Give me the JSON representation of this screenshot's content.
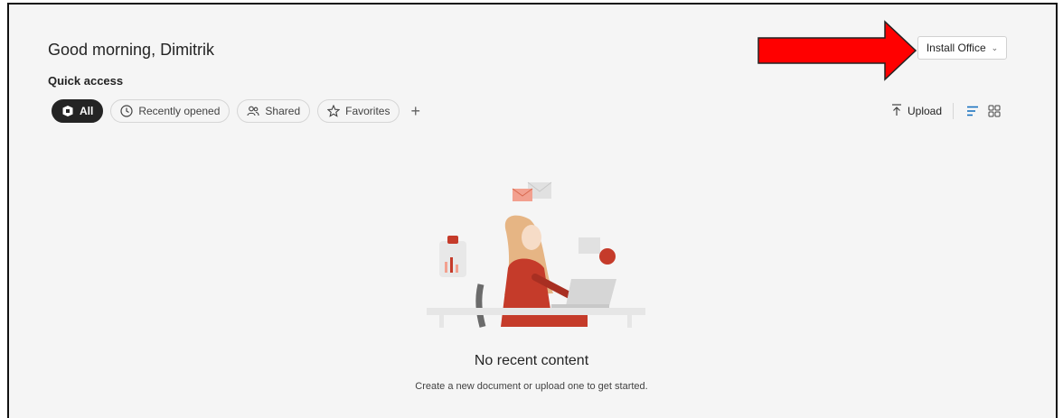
{
  "header": {
    "greeting": "Good morning, Dimitrik",
    "install_label": "Install Office"
  },
  "quick_access": {
    "title": "Quick access",
    "filters": [
      {
        "label": "All",
        "icon": "office-logo-icon",
        "active": true
      },
      {
        "label": "Recently opened",
        "icon": "clock-icon"
      },
      {
        "label": "Shared",
        "icon": "people-icon"
      },
      {
        "label": "Favorites",
        "icon": "star-icon"
      }
    ],
    "add_symbol": "+"
  },
  "toolbar": {
    "upload_label": "Upload"
  },
  "empty_state": {
    "title": "No recent content",
    "subtitle": "Create a new document or upload one to get started."
  },
  "colors": {
    "accent": "#0f6cbd",
    "arrow": "#ff0000",
    "illustration_red": "#c53b2a"
  }
}
